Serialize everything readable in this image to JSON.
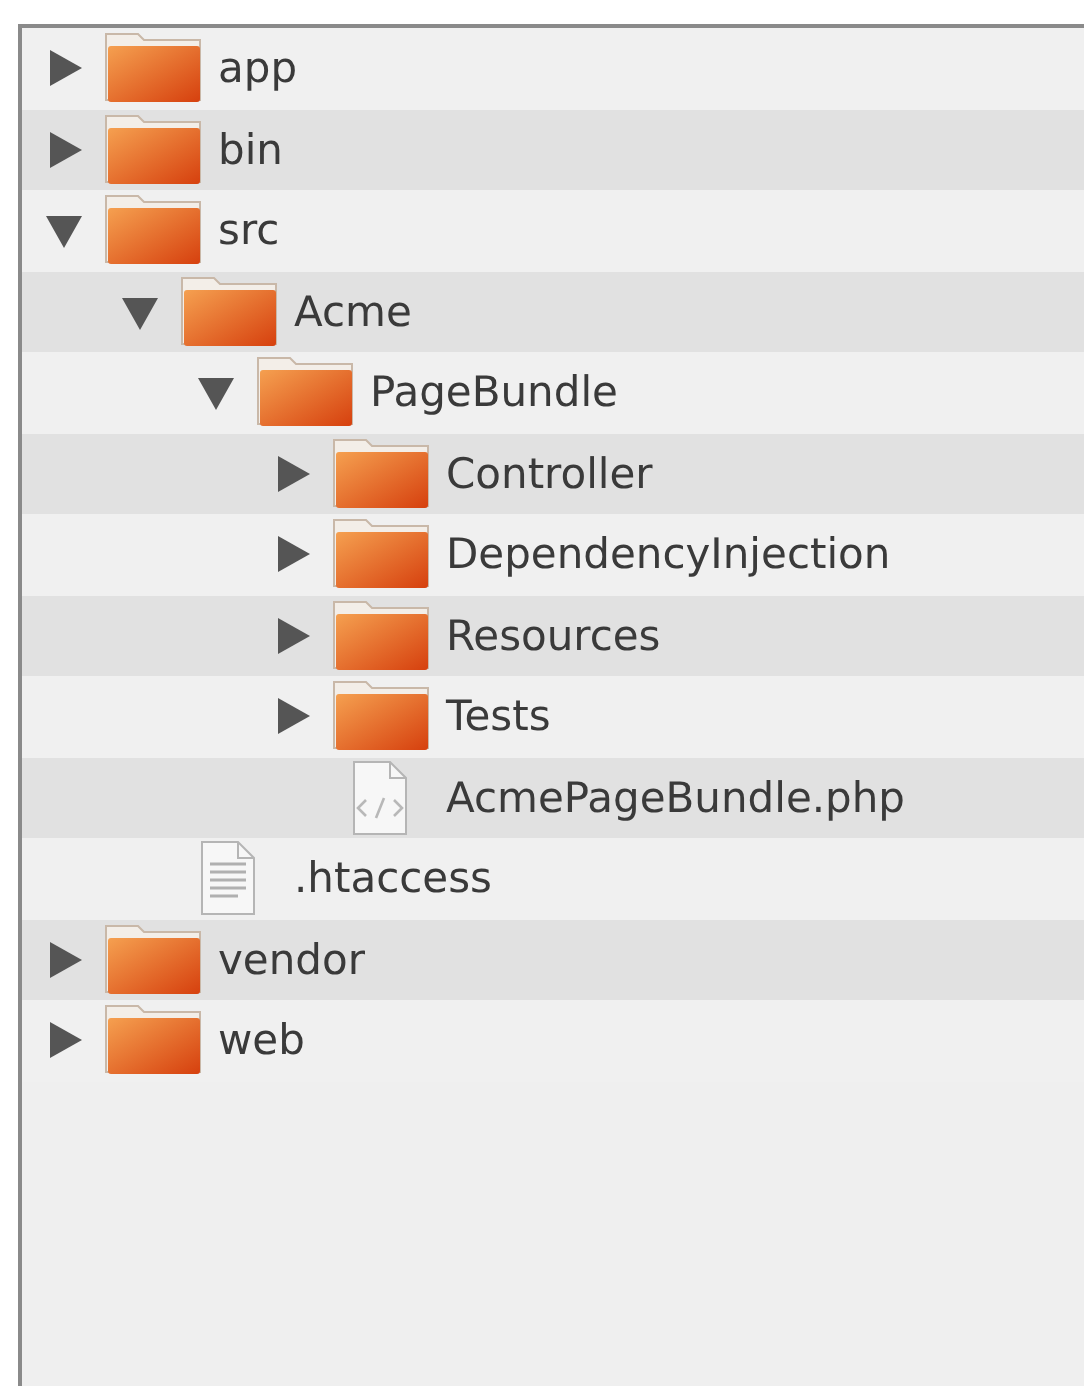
{
  "tree": [
    {
      "kind": "folder",
      "label": "app",
      "expanded": false
    },
    {
      "kind": "folder",
      "label": "bin",
      "expanded": false
    },
    {
      "kind": "folder",
      "label": "src",
      "expanded": true,
      "children": [
        {
          "kind": "folder",
          "label": "Acme",
          "expanded": true,
          "children": [
            {
              "kind": "folder",
              "label": "PageBundle",
              "expanded": true,
              "children": [
                {
                  "kind": "folder",
                  "label": "Controller",
                  "expanded": false
                },
                {
                  "kind": "folder",
                  "label": "DependencyInjection",
                  "expanded": false
                },
                {
                  "kind": "folder",
                  "label": "Resources",
                  "expanded": false
                },
                {
                  "kind": "folder",
                  "label": "Tests",
                  "expanded": false
                },
                {
                  "kind": "code",
                  "label": "AcmePageBundle.php"
                }
              ]
            }
          ]
        },
        {
          "kind": "text",
          "label": ".htaccess"
        }
      ]
    },
    {
      "kind": "folder",
      "label": "vendor",
      "expanded": false
    },
    {
      "kind": "folder",
      "label": "web",
      "expanded": false
    }
  ]
}
